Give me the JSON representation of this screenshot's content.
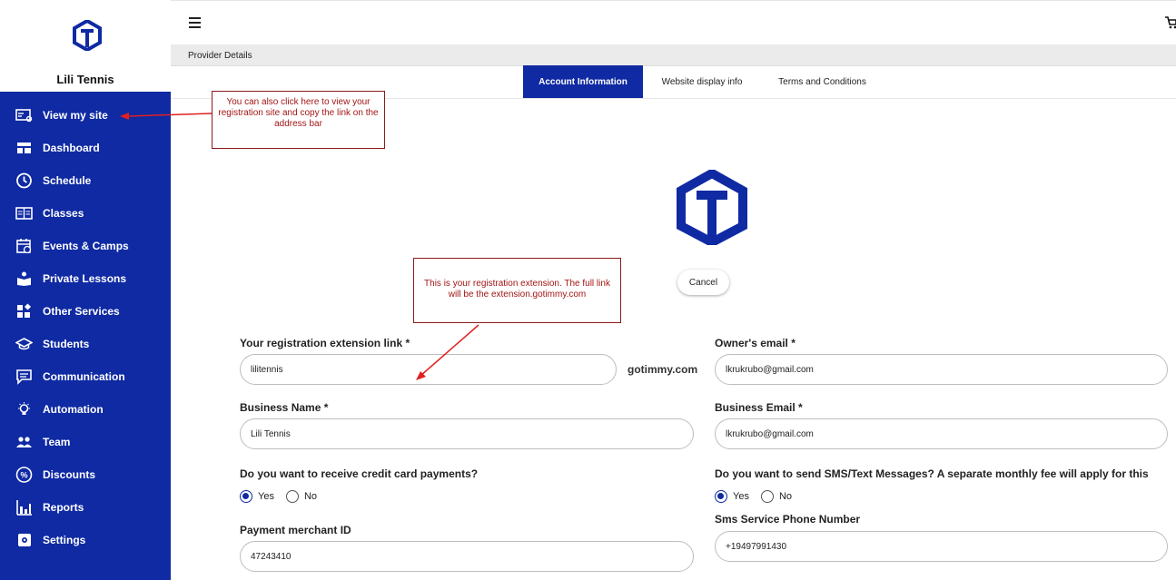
{
  "sidebar": {
    "business_name": "Lili Tennis",
    "items": [
      {
        "label": "View my site",
        "icon": "view-site-icon"
      },
      {
        "label": "Dashboard",
        "icon": "dashboard-icon"
      },
      {
        "label": "Schedule",
        "icon": "clock-icon"
      },
      {
        "label": "Classes",
        "icon": "classes-icon"
      },
      {
        "label": "Events & Camps",
        "icon": "calendar-icon"
      },
      {
        "label": "Private Lessons",
        "icon": "private-lessons-icon"
      },
      {
        "label": "Other Services",
        "icon": "services-icon"
      },
      {
        "label": "Students",
        "icon": "graduation-cap-icon"
      },
      {
        "label": "Communication",
        "icon": "chat-icon"
      },
      {
        "label": "Automation",
        "icon": "lightbulb-icon"
      },
      {
        "label": "Team",
        "icon": "team-icon"
      },
      {
        "label": "Discounts",
        "icon": "percent-icon"
      },
      {
        "label": "Reports",
        "icon": "reports-icon"
      },
      {
        "label": "Settings",
        "icon": "gear-icon"
      }
    ]
  },
  "header": {
    "breadcrumb": "Provider Details"
  },
  "tabs": [
    {
      "label": "Account Information",
      "active": true
    },
    {
      "label": "Website display info",
      "active": false
    },
    {
      "label": "Terms and Conditions",
      "active": false
    }
  ],
  "form": {
    "cancel_label": "Cancel",
    "extension_label": "Your registration extension link *",
    "extension_value": "lilitennis",
    "extension_suffix": "gotimmy.com",
    "owner_email_label": "Owner's email *",
    "owner_email_value": "lkrukrubo@gmail.com",
    "business_name_label": "Business Name *",
    "business_name_value": "Lili Tennis",
    "business_email_label": "Business Email *",
    "business_email_value": "lkrukrubo@gmail.com",
    "credit_card_question": "Do you want to receive credit card payments?",
    "sms_question": "Do you want to send SMS/Text Messages? A separate monthly fee will apply for this",
    "yes_label": "Yes",
    "no_label": "No",
    "merchant_id_label": "Payment merchant ID",
    "merchant_id_value": "47243410",
    "sms_phone_label": "Sms Service Phone Number",
    "sms_phone_value": "+19497991430"
  },
  "callouts": {
    "view_site": "You can also click here to view your registration site  and copy the link on the address bar",
    "extension": "This is your registration extension. The full link will be the extension.gotimmy.com"
  },
  "colors": {
    "brand": "#0f2aa3",
    "callout_text": "#a31515",
    "callout_border": "#8b1a1a"
  }
}
